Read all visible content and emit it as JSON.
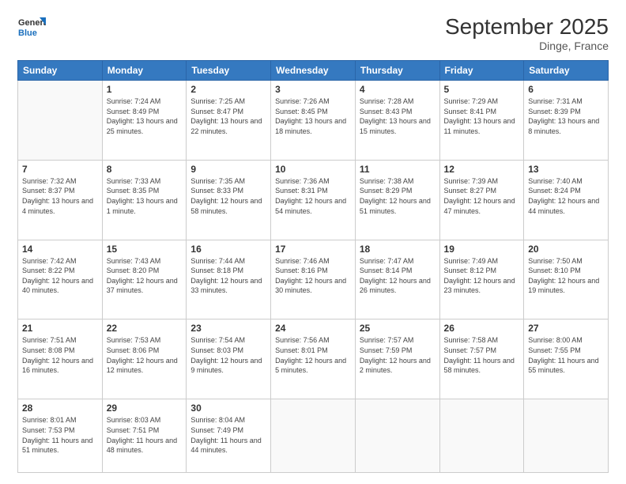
{
  "logo": {
    "line1": "General",
    "line2": "Blue"
  },
  "title": "September 2025",
  "subtitle": "Dinge, France",
  "weekdays": [
    "Sunday",
    "Monday",
    "Tuesday",
    "Wednesday",
    "Thursday",
    "Friday",
    "Saturday"
  ],
  "weeks": [
    [
      {
        "day": "",
        "info": ""
      },
      {
        "day": "1",
        "info": "Sunrise: 7:24 AM\nSunset: 8:49 PM\nDaylight: 13 hours and 25 minutes."
      },
      {
        "day": "2",
        "info": "Sunrise: 7:25 AM\nSunset: 8:47 PM\nDaylight: 13 hours and 22 minutes."
      },
      {
        "day": "3",
        "info": "Sunrise: 7:26 AM\nSunset: 8:45 PM\nDaylight: 13 hours and 18 minutes."
      },
      {
        "day": "4",
        "info": "Sunrise: 7:28 AM\nSunset: 8:43 PM\nDaylight: 13 hours and 15 minutes."
      },
      {
        "day": "5",
        "info": "Sunrise: 7:29 AM\nSunset: 8:41 PM\nDaylight: 13 hours and 11 minutes."
      },
      {
        "day": "6",
        "info": "Sunrise: 7:31 AM\nSunset: 8:39 PM\nDaylight: 13 hours and 8 minutes."
      }
    ],
    [
      {
        "day": "7",
        "info": "Sunrise: 7:32 AM\nSunset: 8:37 PM\nDaylight: 13 hours and 4 minutes."
      },
      {
        "day": "8",
        "info": "Sunrise: 7:33 AM\nSunset: 8:35 PM\nDaylight: 13 hours and 1 minute."
      },
      {
        "day": "9",
        "info": "Sunrise: 7:35 AM\nSunset: 8:33 PM\nDaylight: 12 hours and 58 minutes."
      },
      {
        "day": "10",
        "info": "Sunrise: 7:36 AM\nSunset: 8:31 PM\nDaylight: 12 hours and 54 minutes."
      },
      {
        "day": "11",
        "info": "Sunrise: 7:38 AM\nSunset: 8:29 PM\nDaylight: 12 hours and 51 minutes."
      },
      {
        "day": "12",
        "info": "Sunrise: 7:39 AM\nSunset: 8:27 PM\nDaylight: 12 hours and 47 minutes."
      },
      {
        "day": "13",
        "info": "Sunrise: 7:40 AM\nSunset: 8:24 PM\nDaylight: 12 hours and 44 minutes."
      }
    ],
    [
      {
        "day": "14",
        "info": "Sunrise: 7:42 AM\nSunset: 8:22 PM\nDaylight: 12 hours and 40 minutes."
      },
      {
        "day": "15",
        "info": "Sunrise: 7:43 AM\nSunset: 8:20 PM\nDaylight: 12 hours and 37 minutes."
      },
      {
        "day": "16",
        "info": "Sunrise: 7:44 AM\nSunset: 8:18 PM\nDaylight: 12 hours and 33 minutes."
      },
      {
        "day": "17",
        "info": "Sunrise: 7:46 AM\nSunset: 8:16 PM\nDaylight: 12 hours and 30 minutes."
      },
      {
        "day": "18",
        "info": "Sunrise: 7:47 AM\nSunset: 8:14 PM\nDaylight: 12 hours and 26 minutes."
      },
      {
        "day": "19",
        "info": "Sunrise: 7:49 AM\nSunset: 8:12 PM\nDaylight: 12 hours and 23 minutes."
      },
      {
        "day": "20",
        "info": "Sunrise: 7:50 AM\nSunset: 8:10 PM\nDaylight: 12 hours and 19 minutes."
      }
    ],
    [
      {
        "day": "21",
        "info": "Sunrise: 7:51 AM\nSunset: 8:08 PM\nDaylight: 12 hours and 16 minutes."
      },
      {
        "day": "22",
        "info": "Sunrise: 7:53 AM\nSunset: 8:06 PM\nDaylight: 12 hours and 12 minutes."
      },
      {
        "day": "23",
        "info": "Sunrise: 7:54 AM\nSunset: 8:03 PM\nDaylight: 12 hours and 9 minutes."
      },
      {
        "day": "24",
        "info": "Sunrise: 7:56 AM\nSunset: 8:01 PM\nDaylight: 12 hours and 5 minutes."
      },
      {
        "day": "25",
        "info": "Sunrise: 7:57 AM\nSunset: 7:59 PM\nDaylight: 12 hours and 2 minutes."
      },
      {
        "day": "26",
        "info": "Sunrise: 7:58 AM\nSunset: 7:57 PM\nDaylight: 11 hours and 58 minutes."
      },
      {
        "day": "27",
        "info": "Sunrise: 8:00 AM\nSunset: 7:55 PM\nDaylight: 11 hours and 55 minutes."
      }
    ],
    [
      {
        "day": "28",
        "info": "Sunrise: 8:01 AM\nSunset: 7:53 PM\nDaylight: 11 hours and 51 minutes."
      },
      {
        "day": "29",
        "info": "Sunrise: 8:03 AM\nSunset: 7:51 PM\nDaylight: 11 hours and 48 minutes."
      },
      {
        "day": "30",
        "info": "Sunrise: 8:04 AM\nSunset: 7:49 PM\nDaylight: 11 hours and 44 minutes."
      },
      {
        "day": "",
        "info": ""
      },
      {
        "day": "",
        "info": ""
      },
      {
        "day": "",
        "info": ""
      },
      {
        "day": "",
        "info": ""
      }
    ]
  ]
}
